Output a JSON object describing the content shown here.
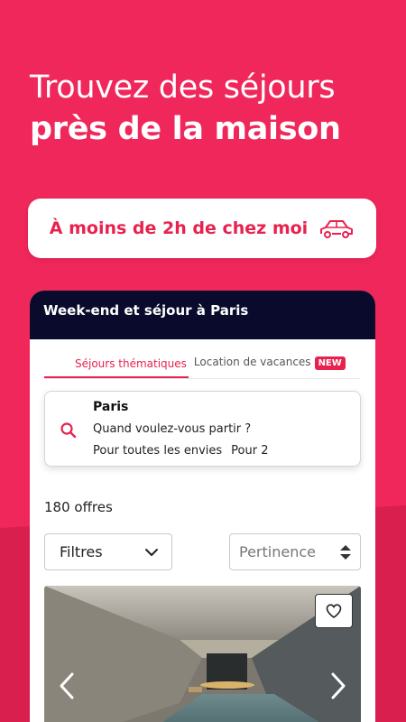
{
  "headline": {
    "line1": "Trouvez des séjours",
    "line2": "près de la maison"
  },
  "near_button": {
    "label": "À moins de 2h de chez moi",
    "icon": "car-icon"
  },
  "card": {
    "title": "Week-end et séjour à Paris",
    "tabs": [
      {
        "label": "Séjours thématiques",
        "active": true
      },
      {
        "label": "Location de vacances",
        "active": false,
        "badge": "NEW"
      }
    ],
    "search": {
      "city": "Paris",
      "when": "Quand voulez-vous partir ?",
      "envies": "Pour toutes les envies",
      "guests": "Pour 2",
      "icon": "search-icon"
    },
    "offers_count": "180 offres",
    "filters_label": "Filtres",
    "sort_placeholder": "Pertinence"
  },
  "colors": {
    "brand": "#f0275a",
    "accent": "#e8224f",
    "header_dark": "#0a0b2c"
  }
}
